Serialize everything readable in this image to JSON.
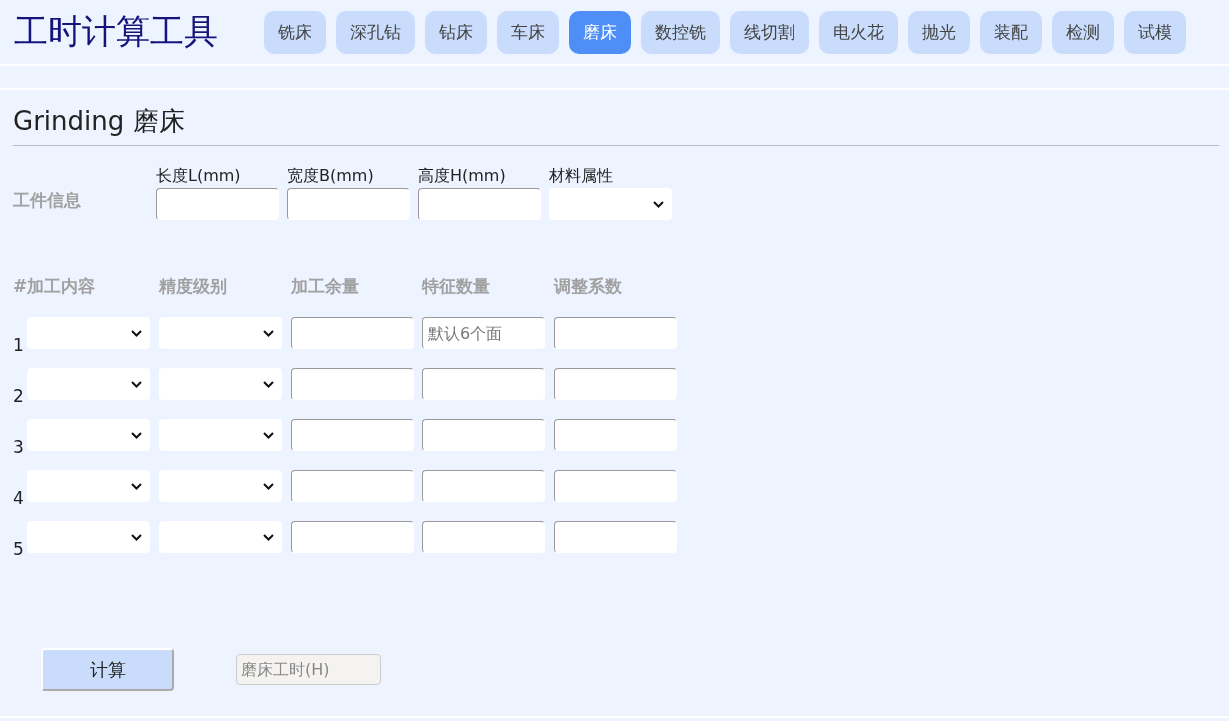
{
  "app_title": "工时计算工具",
  "tabs": [
    {
      "label": "铣床",
      "selected": false
    },
    {
      "label": "深孔钻",
      "selected": false
    },
    {
      "label": "钻床",
      "selected": false
    },
    {
      "label": "车床",
      "selected": false
    },
    {
      "label": "磨床",
      "selected": true
    },
    {
      "label": "数控铣",
      "selected": false
    },
    {
      "label": "线切割",
      "selected": false
    },
    {
      "label": "电火花",
      "selected": false
    },
    {
      "label": "抛光",
      "selected": false
    },
    {
      "label": "装配",
      "selected": false
    },
    {
      "label": "检测",
      "selected": false
    },
    {
      "label": "试模",
      "selected": false
    }
  ],
  "section_title": "Grinding 磨床",
  "workpiece": {
    "label": "工件信息",
    "fields": [
      {
        "label": "长度L(mm)",
        "kind": "input"
      },
      {
        "label": "宽度B(mm)",
        "kind": "input"
      },
      {
        "label": "高度H(mm)",
        "kind": "input"
      },
      {
        "label": "材料属性",
        "kind": "select"
      }
    ]
  },
  "process_table": {
    "columns": [
      "#加工内容",
      "精度级别",
      "加工余量",
      "特征数量",
      "调整系数"
    ],
    "rows": [
      {
        "number": "1",
        "cells": [
          {
            "kind": "select"
          },
          {
            "kind": "select"
          },
          {
            "kind": "input"
          },
          {
            "kind": "input",
            "placeholder": "默认6个面"
          },
          {
            "kind": "input"
          }
        ]
      },
      {
        "number": "2",
        "cells": [
          {
            "kind": "select"
          },
          {
            "kind": "select"
          },
          {
            "kind": "input"
          },
          {
            "kind": "input"
          },
          {
            "kind": "input"
          }
        ]
      },
      {
        "number": "3",
        "cells": [
          {
            "kind": "select"
          },
          {
            "kind": "select"
          },
          {
            "kind": "input"
          },
          {
            "kind": "input"
          },
          {
            "kind": "input"
          }
        ]
      },
      {
        "number": "4",
        "cells": [
          {
            "kind": "select"
          },
          {
            "kind": "select"
          },
          {
            "kind": "input"
          },
          {
            "kind": "input"
          },
          {
            "kind": "input"
          }
        ]
      },
      {
        "number": "5",
        "cells": [
          {
            "kind": "select"
          },
          {
            "kind": "select"
          },
          {
            "kind": "input"
          },
          {
            "kind": "input"
          },
          {
            "kind": "input"
          }
        ]
      }
    ]
  },
  "calculate_button": "计算",
  "result": {
    "placeholder": "磨床工时(H)"
  }
}
